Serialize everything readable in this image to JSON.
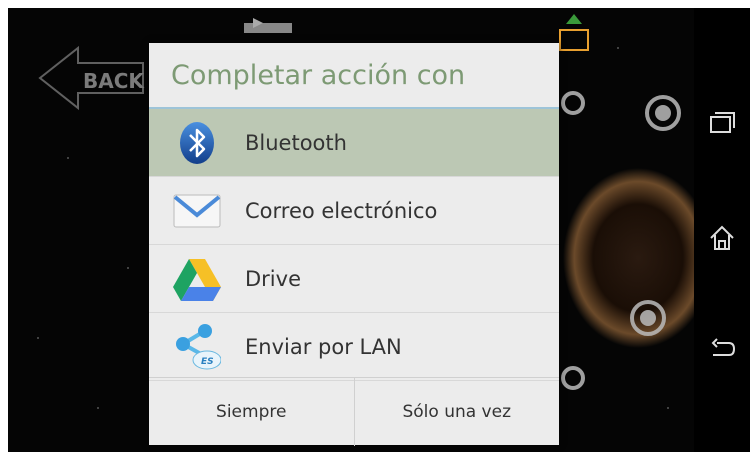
{
  "dialog": {
    "title": "Completar acción con",
    "items": [
      {
        "label": "Bluetooth",
        "icon": "bluetooth-icon",
        "selected": true
      },
      {
        "label": "Correo electrónico",
        "icon": "email-icon",
        "selected": false
      },
      {
        "label": "Drive",
        "icon": "drive-icon",
        "selected": false
      },
      {
        "label": "Enviar por LAN",
        "icon": "es-share-lan-icon",
        "selected": false
      }
    ],
    "buttons": {
      "always": "Siempre",
      "just_once": "Sólo una vez"
    }
  },
  "background": {
    "back_sign": "BACK",
    "nav_icons": [
      "recent-apps-icon",
      "home-icon",
      "back-icon"
    ]
  },
  "colors": {
    "title_text": "#7d9a74",
    "divider": "#9dc4d8",
    "selected_row": "#bcc8b4",
    "dialog_bg": "#ececec"
  }
}
